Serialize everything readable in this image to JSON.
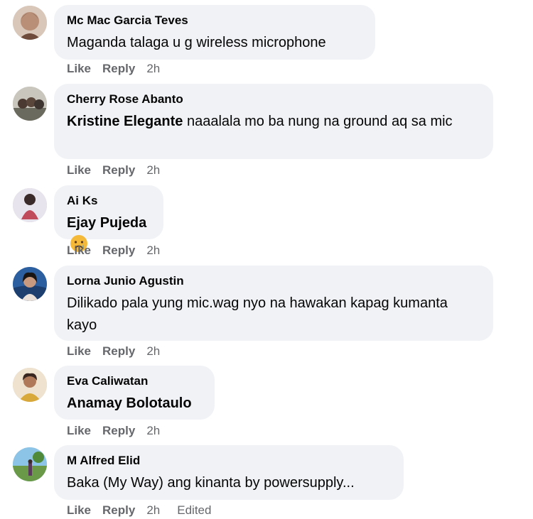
{
  "actions": {
    "like": "Like",
    "reply": "Reply"
  },
  "comments": [
    {
      "author": "Mc Mac Garcia Teves",
      "mention": "",
      "text": "Maganda talaga u g wireless microphone",
      "time": "2h",
      "edited": "",
      "avatar_color": "#b98f77"
    },
    {
      "author": "Cherry Rose Abanto",
      "mention": "Kristine Elegante",
      "text": " naaalala mo ba nung na ground aq sa mic",
      "time": "2h",
      "edited": "",
      "avatar_color": "#8a8a7e"
    },
    {
      "author": "Ai Ks",
      "mention": "Ejay Pujeda",
      "text": "",
      "emoji": "crying-face-icon",
      "time": "2h",
      "edited": "",
      "avatar_color": "#c04a5a"
    },
    {
      "author": "Lorna Junio Agustin",
      "mention": "",
      "text": "Dilikado pala yung mic.wag nyo na hawakan kapag kumanta kayo",
      "time": "2h",
      "edited": "",
      "avatar_color": "#3a3230"
    },
    {
      "author": "Eva Caliwatan",
      "mention": "Anamay Bolotaulo",
      "text": "",
      "time": "2h",
      "edited": "",
      "avatar_color": "#d8a93a"
    },
    {
      "author": "M Alfred Elid",
      "mention": "",
      "text": "Baka (My Way) ang kinanta by powersupply...",
      "time": "2h",
      "edited": "Edited",
      "avatar_color": "#7aa35a"
    }
  ]
}
